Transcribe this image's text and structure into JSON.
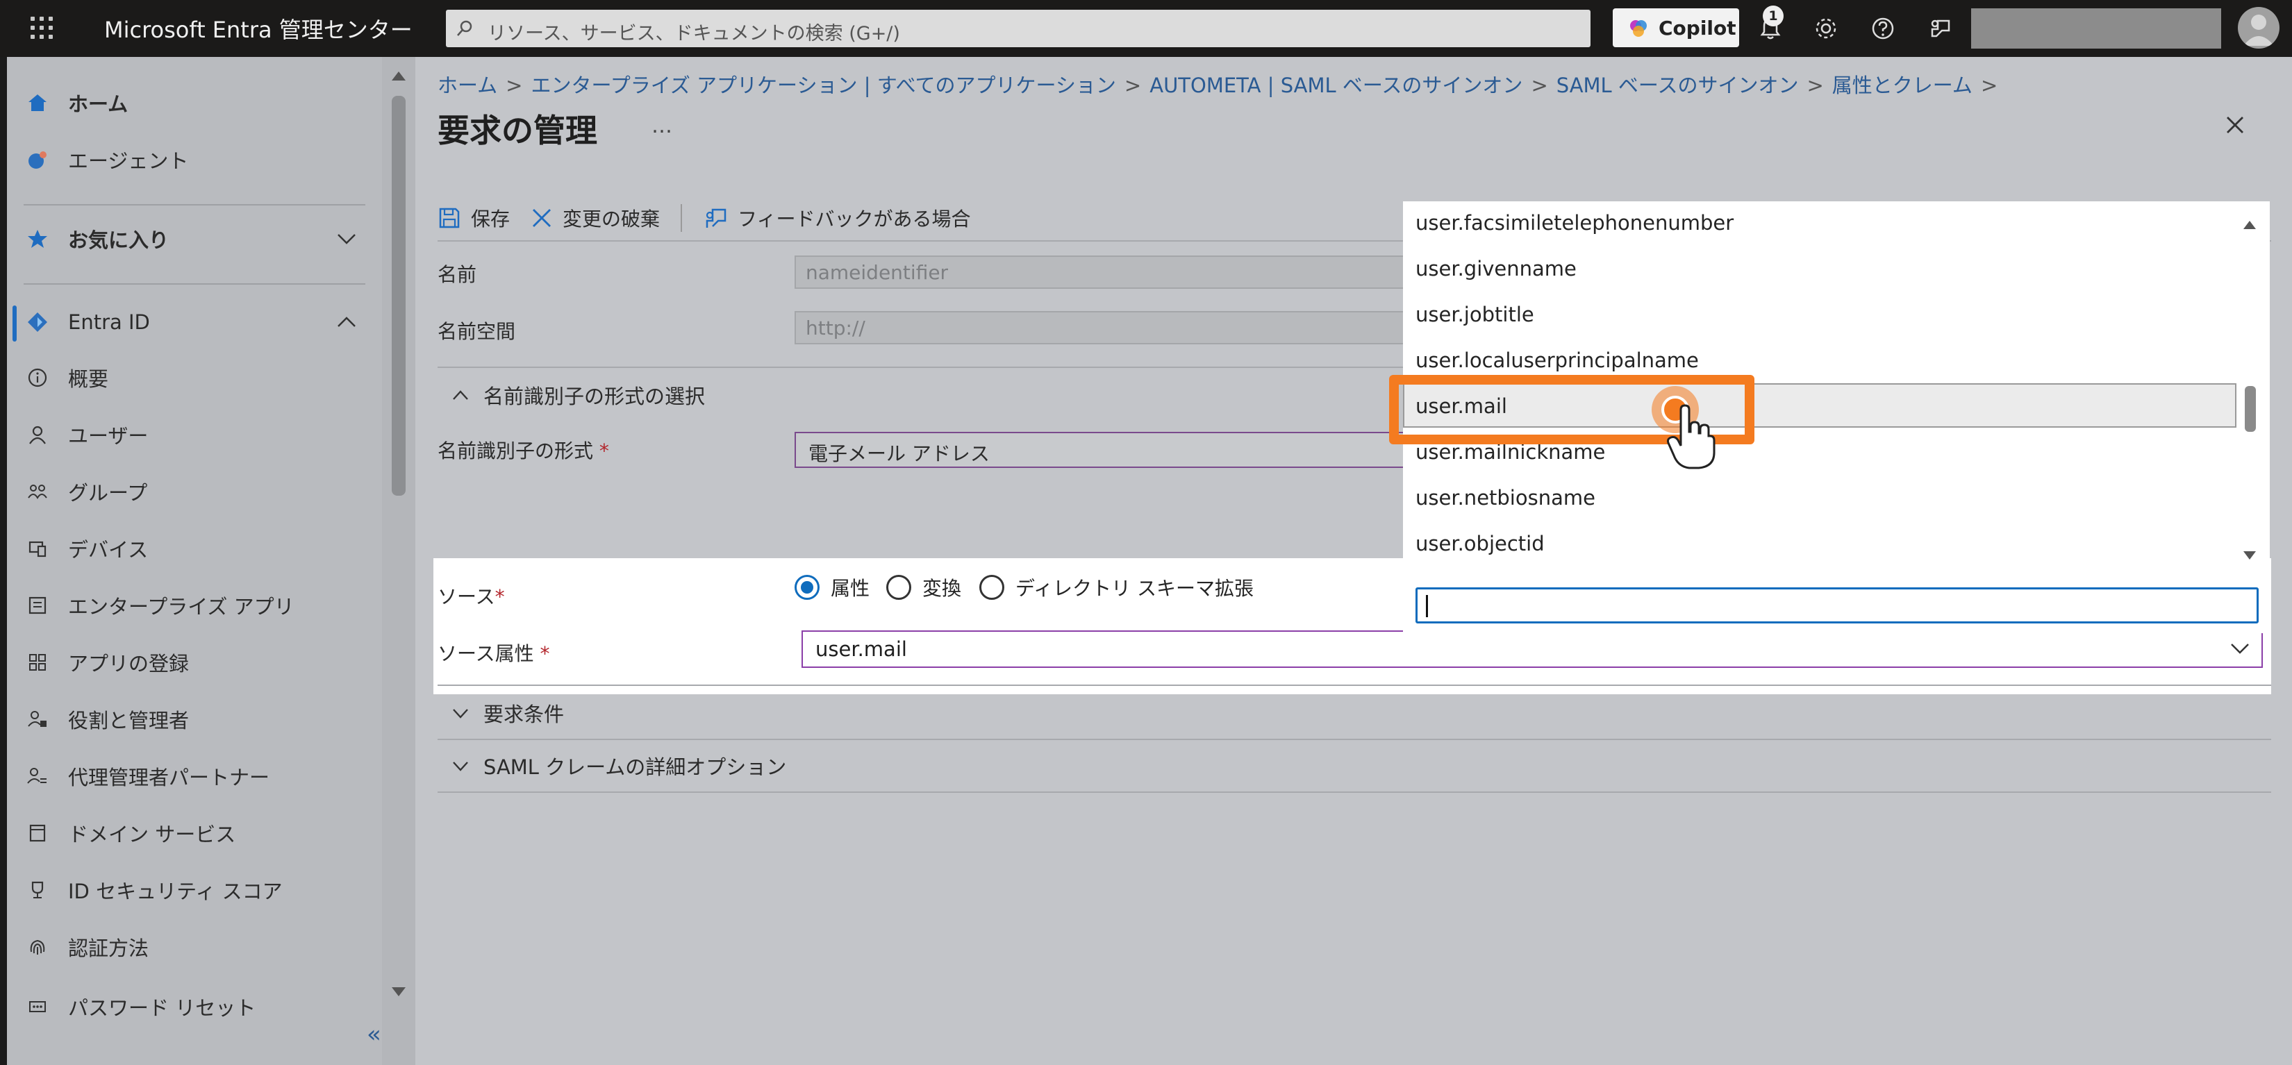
{
  "topbar": {
    "brand": "Microsoft Entra 管理センター",
    "search_placeholder": "リソース、サービス、ドキュメントの検索 (G+/)",
    "copilot_label": "Copilot",
    "notification_count": "1"
  },
  "nav": {
    "items": [
      {
        "label": "ホーム"
      },
      {
        "label": "エージェント"
      },
      {
        "label": "お気に入り"
      },
      {
        "label": "Entra ID"
      },
      {
        "label": "概要"
      },
      {
        "label": "ユーザー"
      },
      {
        "label": "グループ"
      },
      {
        "label": "デバイス"
      },
      {
        "label": "エンタープライズ アプリ"
      },
      {
        "label": "アプリの登録"
      },
      {
        "label": "役割と管理者"
      },
      {
        "label": "代理管理者パートナー"
      },
      {
        "label": "ドメイン サービス"
      },
      {
        "label": "ID セキュリティ スコア"
      },
      {
        "label": "認証方法"
      },
      {
        "label": "パスワード リセット"
      }
    ],
    "collapse_label": "«"
  },
  "breadcrumb": [
    "ホーム",
    "エンタープライズ アプリケーション | すべてのアプリケーション",
    "AUTOMETA | SAML ベースのサインオン",
    "SAML ベースのサインオン",
    "属性とクレーム"
  ],
  "page": {
    "title": "要求の管理",
    "ellipsis": "…",
    "toolbar": {
      "save": "保存",
      "discard": "変更の破棄",
      "feedback": "フィードバックがある場合"
    },
    "name_label": "名前",
    "name_value": "nameidentifier",
    "namespace_label": "名前空間",
    "namespace_placeholder": "http://",
    "nameid_section": "名前識別子の形式の選択",
    "nameid_format_label": "名前識別子の形式",
    "nameid_format_value": "電子メール アドレス",
    "source_label": "ソース",
    "source_options": [
      "属性",
      "変換",
      "ディレクトリ スキーマ拡張"
    ],
    "source_attr_label": "ソース属性",
    "source_attr_value": "user.mail",
    "conditions_section": "要求条件",
    "advanced_section": "SAML クレームの詳細オプション",
    "required_mark": "*"
  },
  "dropdown": {
    "options": [
      "user.facsimiletelephonenumber",
      "user.givenname",
      "user.jobtitle",
      "user.localuserprincipalname",
      "user.mail",
      "user.mailnickname",
      "user.netbiosname",
      "user.objectid"
    ],
    "selected": "user.mail"
  },
  "colors": {
    "accent": "#0f6cbd",
    "highlight": "#f47b20",
    "required": "#b3262c"
  }
}
